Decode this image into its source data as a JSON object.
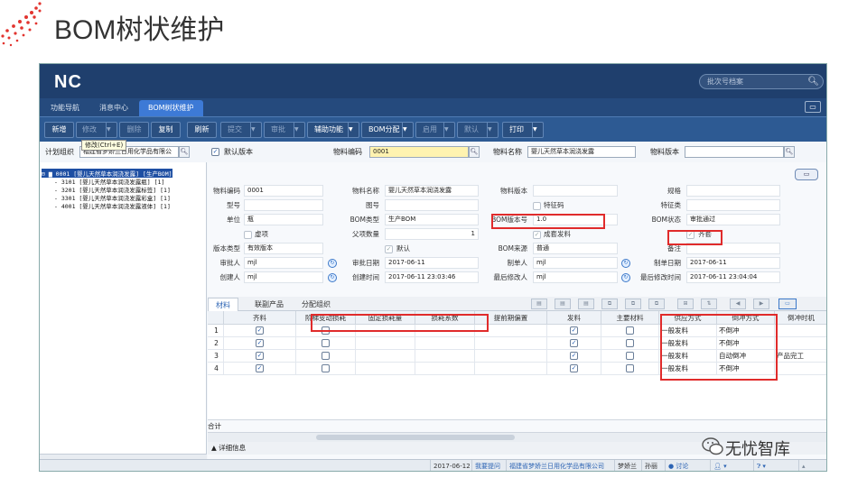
{
  "slide_title": "BOM树状维护",
  "app": {
    "logo": "NC",
    "top_search_placeholder": "批次号档案",
    "tabs": [
      "功能导航",
      "消息中心",
      "BOM树状维护"
    ],
    "toolbar": [
      {
        "label": "新增",
        "dropdown": false,
        "enabled": true
      },
      {
        "label": "修改",
        "dropdown": true,
        "enabled": false
      },
      {
        "label": "删除",
        "dropdown": false,
        "enabled": false
      },
      {
        "label": "复制",
        "dropdown": false,
        "enabled": true
      },
      {
        "label": "刷新",
        "dropdown": false,
        "enabled": true
      },
      {
        "label": "提交",
        "dropdown": true,
        "enabled": false
      },
      {
        "label": "审批",
        "dropdown": true,
        "enabled": false
      },
      {
        "label": "辅助功能",
        "dropdown": true,
        "enabled": true
      },
      {
        "label": "BOM分配",
        "dropdown": true,
        "enabled": true
      },
      {
        "label": "启用",
        "dropdown": true,
        "enabled": false
      },
      {
        "label": "默认",
        "dropdown": true,
        "enabled": false
      },
      {
        "label": "打印",
        "dropdown": true,
        "enabled": true
      }
    ],
    "tooltip": "修改(Ctrl+E)",
    "filter": {
      "org_label": "计划组织",
      "org_value": "福建省梦娇兰日用化学品有限公",
      "default_version_label": "默认版本",
      "default_version_checked": true,
      "material_code_label": "物料编码",
      "material_code_value": "0001",
      "material_name_label": "物料名称",
      "material_name_value": "婴儿天然草本润浇发露",
      "material_version_label": "物料版本",
      "material_version_value": ""
    },
    "tree": [
      {
        "text": "0001 [婴儿天然草本润浇发露] [生产BOM]",
        "level": 0,
        "selected": true
      },
      {
        "text": "3101 [婴儿天然草本润浇发露瓶] [1]",
        "level": 1,
        "selected": false
      },
      {
        "text": "3201 [婴儿天然草本润浇发露标签] [1]",
        "level": 1,
        "selected": false
      },
      {
        "text": "3301 [婴儿天然草本润浇发露彩盒] [1]",
        "level": 1,
        "selected": false
      },
      {
        "text": "4001 [婴儿天然草本润浇发露液体] [1]",
        "level": 1,
        "selected": false
      }
    ],
    "form": {
      "material_code": {
        "label": "物料编码",
        "value": "0001"
      },
      "material_name": {
        "label": "物料名称",
        "value": "婴儿天然草本润浇发露"
      },
      "material_version": {
        "label": "物料版本",
        "value": ""
      },
      "spec": {
        "label": "规格",
        "value": ""
      },
      "model": {
        "label": "型号",
        "value": ""
      },
      "drawing_no": {
        "label": "图号",
        "value": ""
      },
      "feature_code": {
        "label": "特征码",
        "value": ""
      },
      "feature_class": {
        "label": "特征类",
        "value": ""
      },
      "unit": {
        "label": "单位",
        "value": "瓶"
      },
      "bom_type": {
        "label": "BOM类型",
        "value": "生产BOM"
      },
      "bom_version": {
        "label": "BOM版本号",
        "value": "1.0"
      },
      "bom_status": {
        "label": "BOM状态",
        "value": "审批通过"
      },
      "virtual_item": {
        "label": "虚项",
        "checked": false
      },
      "parent_qty": {
        "label": "父项数量",
        "value": "1"
      },
      "kit_issue": {
        "label": "成套发料",
        "checked": true
      },
      "complete_set": {
        "label": "齐套",
        "checked": true
      },
      "version_type": {
        "label": "版本类型",
        "value": "有效版本"
      },
      "default": {
        "label": "默认",
        "checked": true
      },
      "bom_source": {
        "label": "BOM来源",
        "value": "普通"
      },
      "remark": {
        "label": "备注",
        "value": ""
      },
      "approver": {
        "label": "审批人",
        "value": "mjl"
      },
      "approve_date": {
        "label": "审批日期",
        "value": "2017-06-11"
      },
      "maker": {
        "label": "制单人",
        "value": "mjl"
      },
      "make_date": {
        "label": "制单日期",
        "value": "2017-06-11"
      },
      "creator": {
        "label": "创建人",
        "value": "mjl"
      },
      "create_time": {
        "label": "创建时间",
        "value": "2017-06-11 23:03:46"
      },
      "modifier": {
        "label": "最后修改人",
        "value": "mjl"
      },
      "modify_time": {
        "label": "最后修改时间",
        "value": "2017-06-11 23:04:04"
      }
    },
    "subtabs": [
      "材料",
      "联副产品",
      "分配组织"
    ],
    "grid": {
      "columns": [
        "齐料",
        "阶梯变动损耗",
        "固定损耗量",
        "损耗系数",
        "提前期偏置",
        "发料",
        "主要材料",
        "供应方式",
        "倒冲方式",
        "倒冲时机"
      ],
      "rows": [
        {
          "no": "1",
          "qiliao": true,
          "jieti": false,
          "fayliao": true,
          "zhuyao": false,
          "supply": "一般发料",
          "backflush": "不倒冲",
          "timing": ""
        },
        {
          "no": "2",
          "qiliao": true,
          "jieti": false,
          "fayliao": true,
          "zhuyao": false,
          "supply": "一般发料",
          "backflush": "不倒冲",
          "timing": ""
        },
        {
          "no": "3",
          "qiliao": true,
          "jieti": false,
          "fayliao": true,
          "zhuyao": false,
          "supply": "一般发料",
          "backflush": "自动倒冲",
          "timing": "产品完工"
        },
        {
          "no": "4",
          "qiliao": true,
          "jieti": false,
          "fayliao": true,
          "zhuyao": false,
          "supply": "一般发料",
          "backflush": "不倒冲",
          "timing": ""
        }
      ],
      "summary_label": "合计",
      "detail_label": "详细信息"
    },
    "status": {
      "date": "2017-06-12",
      "question": "我要提问",
      "company": "福建省梦娇兰日用化学品有限公司",
      "user1": "梦娇兰",
      "user2": "孙丽",
      "discuss": "讨论"
    }
  },
  "watermark": "无忧智库",
  "colors": {
    "highlight_box": "#e02b2b",
    "accent": "#3d7ad6",
    "header": "#1f3f6d"
  }
}
